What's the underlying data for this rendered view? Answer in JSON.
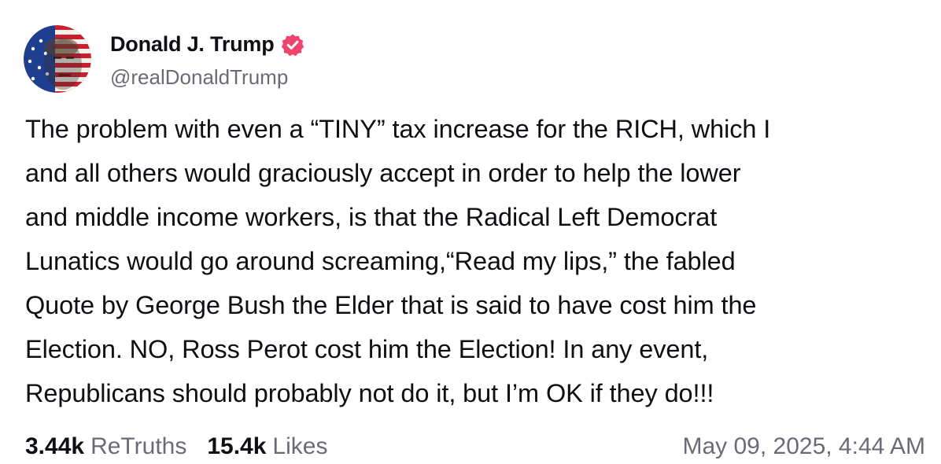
{
  "author": {
    "display_name": "Donald J. Trump",
    "handle": "@realDonaldTrump",
    "verified_badge_color": "#f0436e",
    "avatar": "stars-and-stripes-portrait"
  },
  "post": {
    "text": "The problem with even a “TINY” tax increase for the RICH, which I\nand all others would graciously accept in order to help the lower\nand middle income workers, is that the Radical Left Democrat\nLunatics would go around screaming,“Read my lips,” the fabled\nQuote by George Bush the Elder that is said to have cost him the\nElection. NO, Ross Perot cost him the Election! In any event,\nRepublicans should probably not do it, but I’m OK if they do!!!"
  },
  "stats": {
    "retruths_count": "3.44k",
    "retruths_label": "ReTruths",
    "likes_count": "15.4k",
    "likes_label": "Likes",
    "timestamp": "May 09, 2025, 4:44 AM"
  },
  "colors": {
    "text": "#0f0f14",
    "muted": "#6b6b78",
    "background": "#ffffff"
  }
}
